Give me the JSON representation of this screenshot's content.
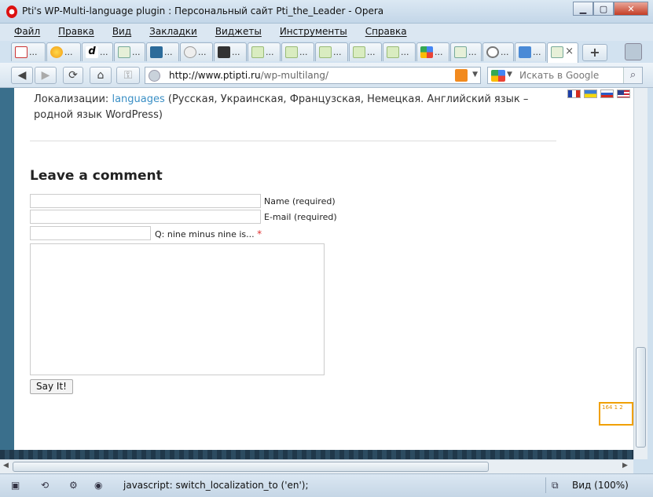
{
  "window": {
    "title": "Pti's WP-Multi-language plugin : Персональный сайт Pti_the_Leader - Opera"
  },
  "menu": [
    "Файл",
    "Правка",
    "Вид",
    "Закладки",
    "Виджеты",
    "Инструменты",
    "Справка"
  ],
  "tabs": [
    "gmail",
    "sun",
    "d",
    "page",
    "grid",
    "bolt",
    "printer",
    "fox",
    "fox",
    "fox",
    "fox",
    "fox",
    "google",
    "page",
    "wordpress",
    "translate",
    "page-active"
  ],
  "tab_dots": "...",
  "address": {
    "host": "http://www.ptipti.ru",
    "path": "/wp-multilang/"
  },
  "search": {
    "placeholder": "Искать в Google"
  },
  "page": {
    "localizations_label": "Локализации: ",
    "localizations_link": "languages",
    "localizations_rest": " (Русская, Украинская, Французская, Немецкая. Английский язык – родной язык WordPress)",
    "comment_heading": "Leave a comment",
    "name_label": "Name (required)",
    "email_label": "E-mail (required)",
    "captcha_label": "Q: nine minus nine is...",
    "required_mark": "*",
    "submit_label": "Say It!",
    "counter_text": "164 1 2"
  },
  "status": {
    "text": "javascript: switch_localization_to ('en');",
    "zoom": "Вид (100%)"
  },
  "colors": {
    "accent_link": "#3a8fc5",
    "page_band": "#3a6f8c",
    "counter": "#f0a000"
  }
}
